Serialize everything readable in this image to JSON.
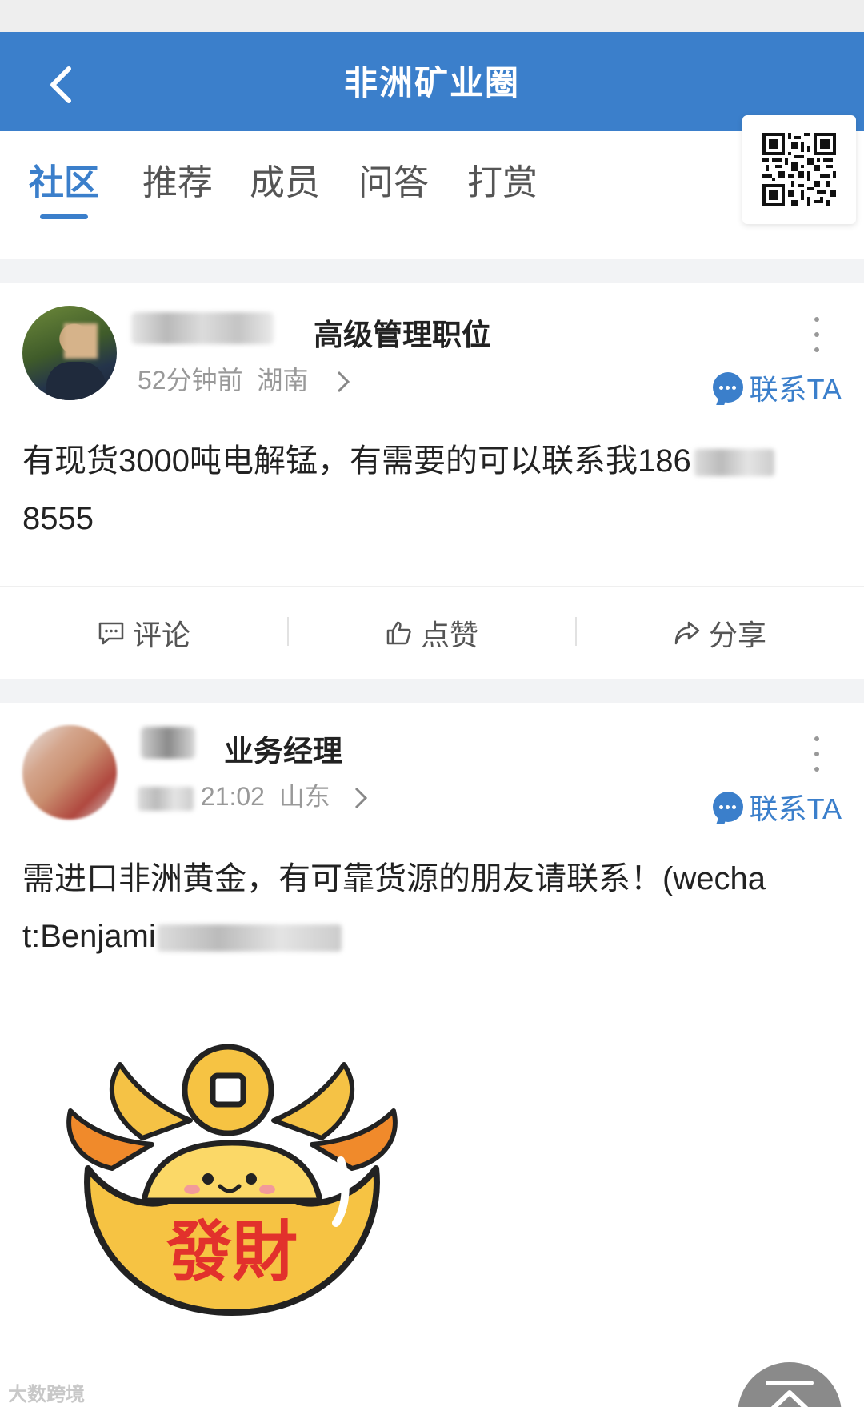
{
  "nav": {
    "title": "非洲矿业圈"
  },
  "tabs": [
    "社区",
    "推荐",
    "成员",
    "问答",
    "打赏"
  ],
  "posts": [
    {
      "user_title": "高级管理职位",
      "time": "52分钟前",
      "location": "湖南",
      "contact_label": "联系TA",
      "text_line1": "有现货3000吨电解锰，有需要的可以联系我186",
      "text_line2": "8555"
    },
    {
      "user_title": "业务经理",
      "time": "21:02",
      "location": "山东",
      "contact_label": "联系TA",
      "text_line1": "需进口非洲黄金，有可靠货源的朋友请联系！(wecha",
      "text_line2": "t:Benjami"
    }
  ],
  "actions": {
    "comment": "评论",
    "like": "点赞",
    "share": "分享"
  },
  "sticker": {
    "text": "發財"
  },
  "watermark": "大数跨境",
  "colors": {
    "primary": "#3b7fcb",
    "sticker_gold": "#f6c343",
    "sticker_red": "#e2312c"
  }
}
